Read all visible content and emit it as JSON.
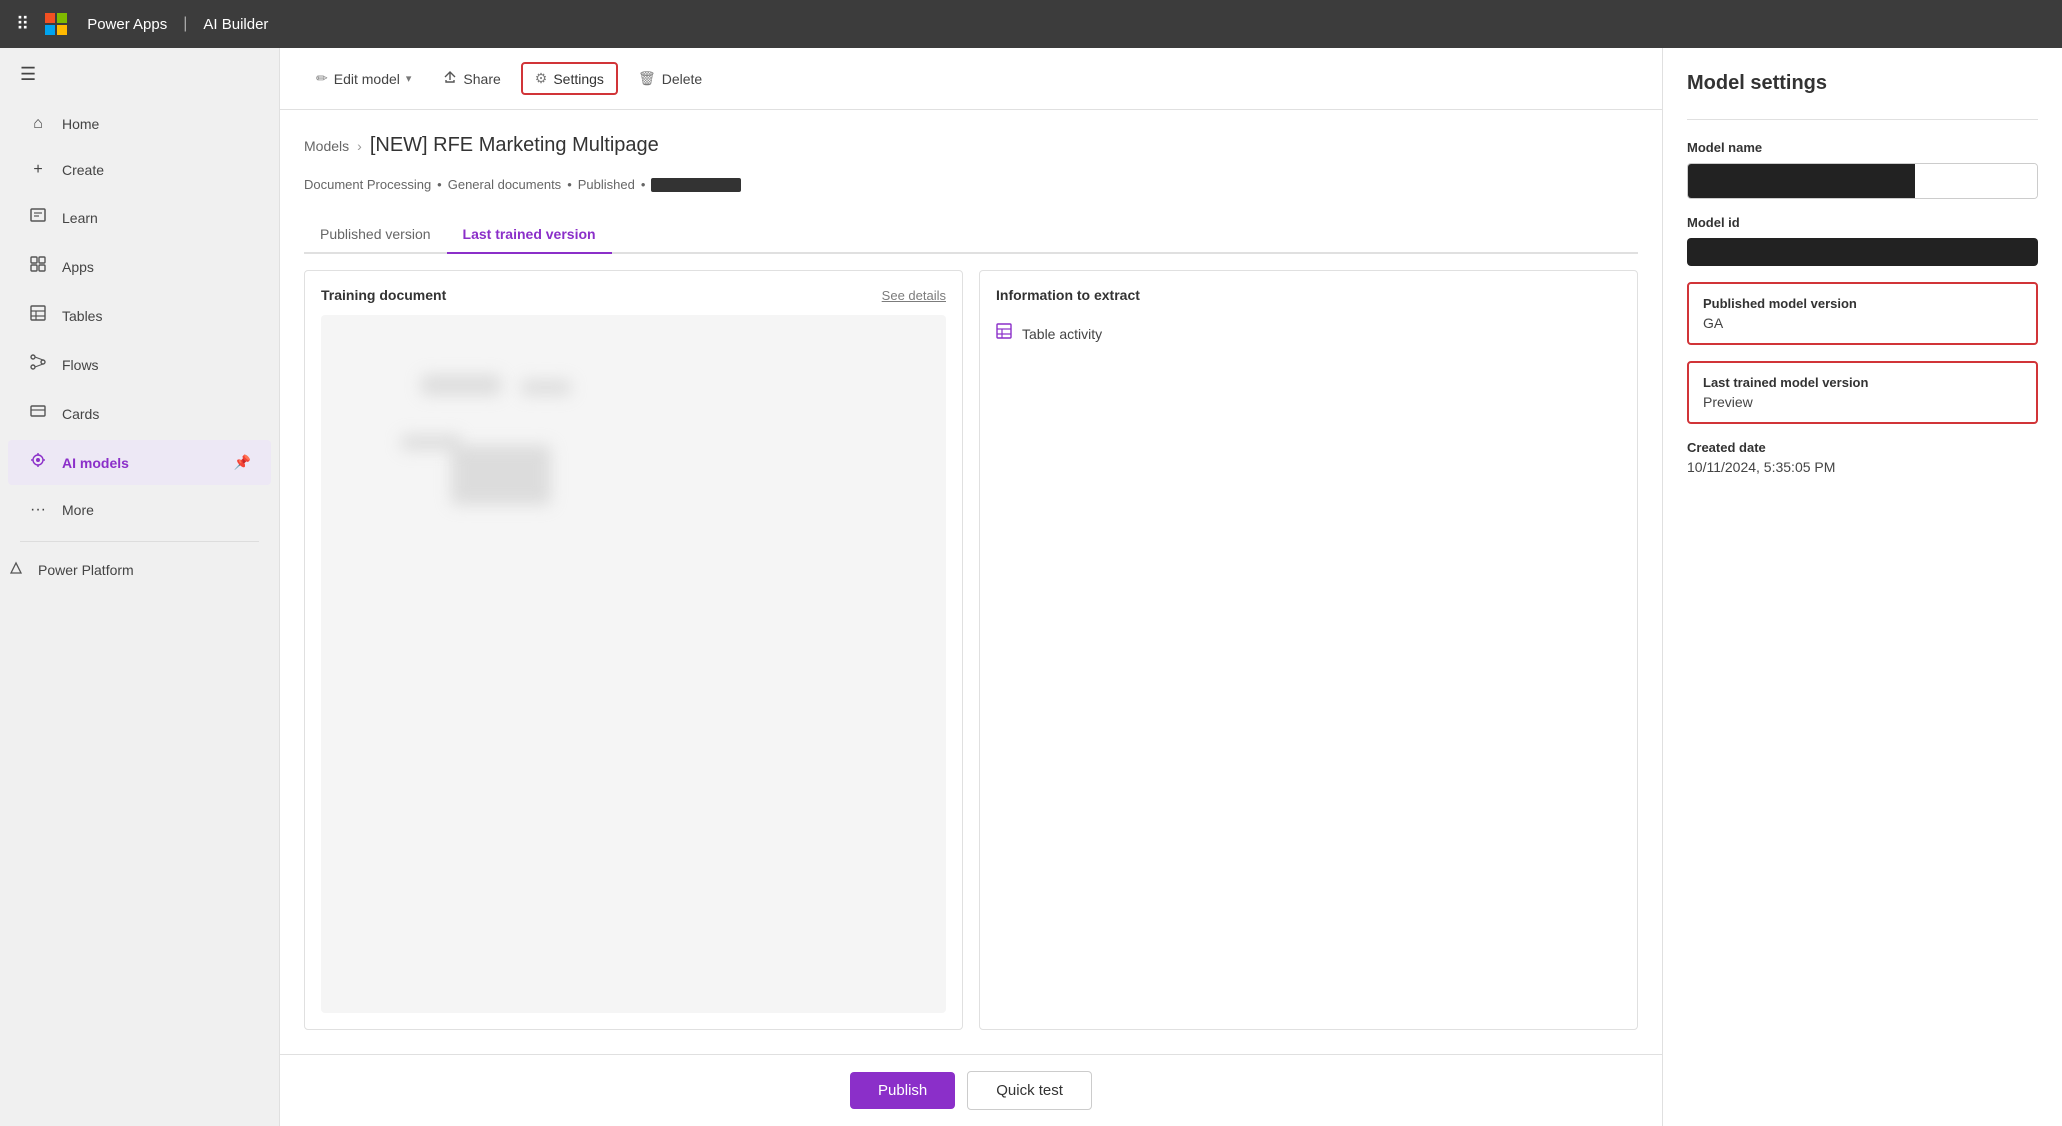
{
  "topbar": {
    "title": "Power Apps",
    "separator": "|",
    "product": "AI Builder"
  },
  "sidebar": {
    "items": [
      {
        "id": "home",
        "label": "Home",
        "icon": "⌂"
      },
      {
        "id": "create",
        "label": "Create",
        "icon": "+"
      },
      {
        "id": "learn",
        "label": "Learn",
        "icon": "□"
      },
      {
        "id": "apps",
        "label": "Apps",
        "icon": "⊞"
      },
      {
        "id": "tables",
        "label": "Tables",
        "icon": "⊟"
      },
      {
        "id": "flows",
        "label": "Flows",
        "icon": "⚙"
      },
      {
        "id": "cards",
        "label": "Cards",
        "icon": "▭"
      },
      {
        "id": "ai-models",
        "label": "AI models",
        "icon": "◈",
        "active": true
      },
      {
        "id": "more",
        "label": "More",
        "icon": "···"
      }
    ],
    "bottom": {
      "label": "Power Platform",
      "icon": "⬡"
    }
  },
  "toolbar": {
    "edit_model_label": "Edit model",
    "share_label": "Share",
    "settings_label": "Settings",
    "delete_label": "Delete"
  },
  "breadcrumb": {
    "parent": "Models",
    "current": "[NEW] RFE Marketing Multipage"
  },
  "subtitle": {
    "type": "Document Processing",
    "category": "General documents",
    "status": "Published"
  },
  "tabs": [
    {
      "id": "published",
      "label": "Published version",
      "active": false
    },
    {
      "id": "last-trained",
      "label": "Last trained version",
      "active": true
    }
  ],
  "training_card": {
    "title": "Training document",
    "link": "See details"
  },
  "info_card": {
    "title": "Information to extract",
    "items": [
      {
        "label": "Table activity",
        "icon": "⊞"
      }
    ]
  },
  "actions": {
    "publish": "Publish",
    "quick_test": "Quick test"
  },
  "right_panel": {
    "title": "Model settings",
    "model_name_label": "Model name",
    "model_id_label": "Model id",
    "published_version_label": "Published model version",
    "published_version_value": "GA",
    "last_trained_label": "Last trained model version",
    "last_trained_value": "Preview",
    "created_date_label": "Created date",
    "created_date_value": "10/11/2024, 5:35:05 PM"
  }
}
